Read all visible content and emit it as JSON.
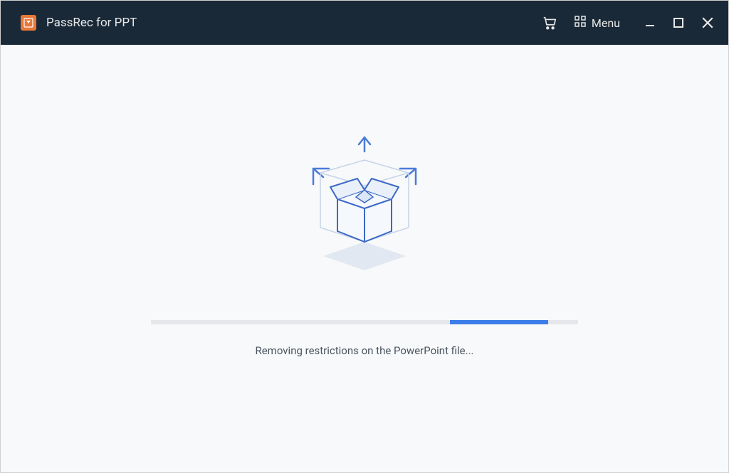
{
  "header": {
    "app_title": "PassRec for PPT",
    "menu_label": "Menu"
  },
  "main": {
    "status_text": "Removing restrictions on the PowerPoint file...",
    "progress": {
      "offset_percent": 70,
      "width_percent": 23
    }
  },
  "colors": {
    "titlebar_bg": "#1a2938",
    "app_icon_bg": "#e97838",
    "accent": "#3b7ee8",
    "content_bg": "#f8f9fa"
  }
}
